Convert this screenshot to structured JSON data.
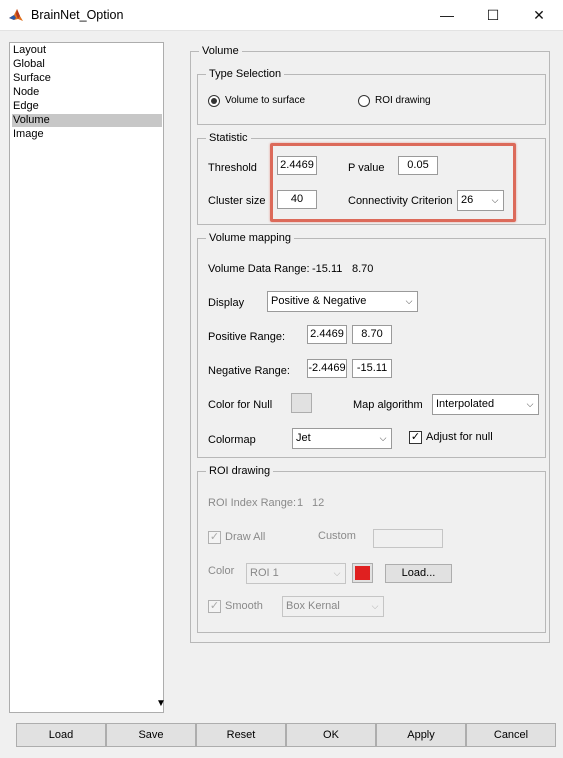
{
  "window": {
    "title": "BrainNet_Option",
    "minimize_glyph": "—",
    "maximize_glyph": "☐",
    "close_glyph": "✕"
  },
  "sidebar": {
    "items": [
      {
        "label": "Layout"
      },
      {
        "label": "Global"
      },
      {
        "label": "Surface"
      },
      {
        "label": "Node"
      },
      {
        "label": "Edge"
      },
      {
        "label": "Volume"
      },
      {
        "label": "Image"
      }
    ],
    "selected": "Volume",
    "scroll_down_glyph": "▼"
  },
  "volume": {
    "title": "Volume",
    "type_selection": {
      "title": "Type Selection",
      "options": [
        {
          "label": "Volume to surface",
          "selected": true
        },
        {
          "label": "ROI drawing",
          "selected": false
        }
      ]
    },
    "statistic": {
      "title": "Statistic",
      "threshold_label": "Threshold",
      "threshold_value": "2.4469",
      "pvalue_label": "P value",
      "pvalue_value": "0.05",
      "cluster_label": "Cluster size",
      "cluster_value": "40",
      "connectivity_label": "Connectivity Criterion",
      "connectivity_value": "26"
    },
    "volume_mapping": {
      "title": "Volume mapping",
      "data_range_label": "Volume Data Range:",
      "data_range_min": "-15.11",
      "data_range_max": "8.70",
      "display_label": "Display",
      "display_value": "Positive & Negative",
      "positive_label": "Positive Range:",
      "positive_min": "2.4469",
      "positive_max": "8.70",
      "negative_label": "Negative Range:",
      "negative_min": "-2.4469",
      "negative_max": "-15.11",
      "color_null_label": "Color for Null",
      "map_algorithm_label": "Map algorithm",
      "map_algorithm_value": "Interpolated",
      "colormap_label": "Colormap",
      "colormap_value": "Jet",
      "adjust_null_label": "Adjust for null",
      "adjust_null_checked": true
    },
    "roi_drawing": {
      "title": "ROI drawing",
      "index_range_label": "ROI Index Range:",
      "index_min": "1",
      "index_max": "12",
      "draw_all_label": "Draw All",
      "draw_all_checked": true,
      "custom_label": "Custom",
      "custom_value": "",
      "color_label": "Color",
      "color_roi_value": "ROI 1",
      "roi_color": "#e02020",
      "load_label": "Load...",
      "smooth_label": "Smooth",
      "smooth_checked": true,
      "smooth_value": "Box Kernal"
    }
  },
  "buttons": {
    "load": "Load",
    "save": "Save",
    "reset": "Reset",
    "ok": "OK",
    "apply": "Apply",
    "cancel": "Cancel"
  },
  "colors": {
    "highlight": "#dc6a5a",
    "selection": "#c7c7c7",
    "roi_swatch": "#e02020"
  },
  "check_glyph": "✓"
}
